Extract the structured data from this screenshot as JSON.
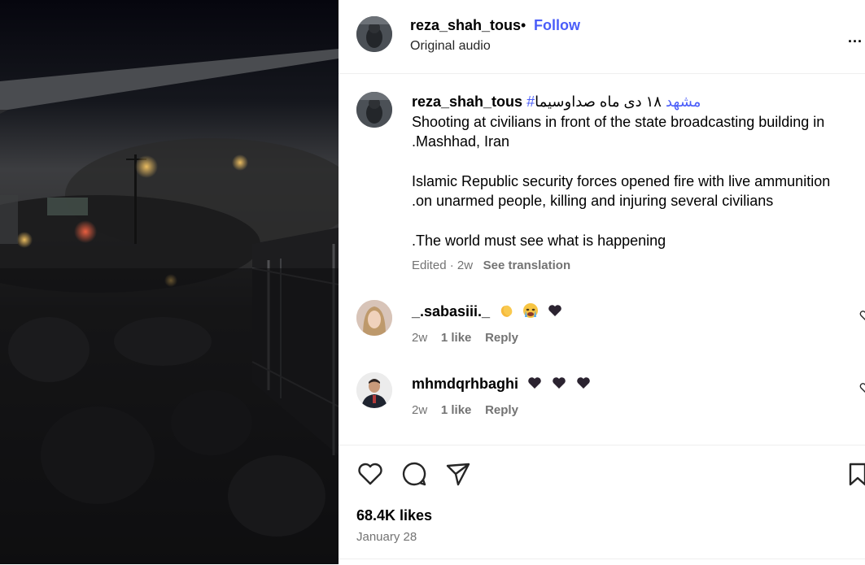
{
  "header": {
    "username": "reza_shah_tous",
    "separator": "•",
    "follow_label": "Follow",
    "audio_label": "Original audio",
    "more_label": "..."
  },
  "caption": {
    "username": "reza_shah_tous",
    "hashtag": "#مشهد",
    "persian_text": "۱۸ دی ماه صداوسیما",
    "line1": "Shooting at civilians in front of the state broadcasting building in",
    "line2": ".Mashhad, Iran",
    "line3": "Islamic Republic security forces opened fire with live ammunition",
    "line4": ".on unarmed people, killing and injuring several civilians",
    "line5": ".The world must see what is happening",
    "edited_label": "Edited",
    "time_sep": "·",
    "time": "2w",
    "translate_label": "See translation"
  },
  "comments": [
    {
      "username": "_.sabasiii._",
      "emojis": [
        "clapping-hands",
        "crying-face",
        "black-heart"
      ],
      "time": "2w",
      "likes": "1 like",
      "reply": "Reply"
    },
    {
      "username": "mhmdqrhbaghi",
      "emojis": [
        "black-heart",
        "black-heart",
        "black-heart"
      ],
      "time": "2w",
      "likes": "1 like",
      "reply": "Reply"
    }
  ],
  "footer": {
    "likes_count": "68.4K likes",
    "date": "January 28"
  },
  "colors": {
    "accent": "#4a5df9",
    "muted": "#737373",
    "divider": "#efefef"
  }
}
